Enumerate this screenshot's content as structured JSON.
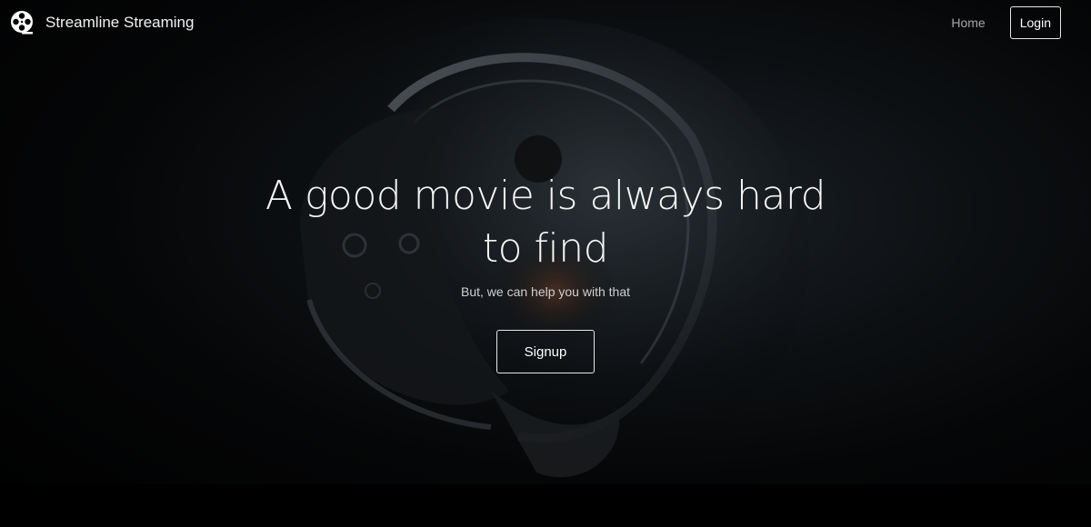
{
  "navbar": {
    "brand_text": "Streamline Streaming",
    "brand_icon": "film-reel-icon",
    "home_label": "Home",
    "login_label": "Login"
  },
  "hero": {
    "title": "A good movie is always hard to find",
    "subtitle": "But, we can help you with that",
    "signup_label": "Signup",
    "background_image": "astronaut-helmet-image"
  },
  "colors": {
    "background": "#000000",
    "text": "#ffffff",
    "nav_link": "#a7a7a7",
    "subtitle": "#cfcfcf"
  }
}
